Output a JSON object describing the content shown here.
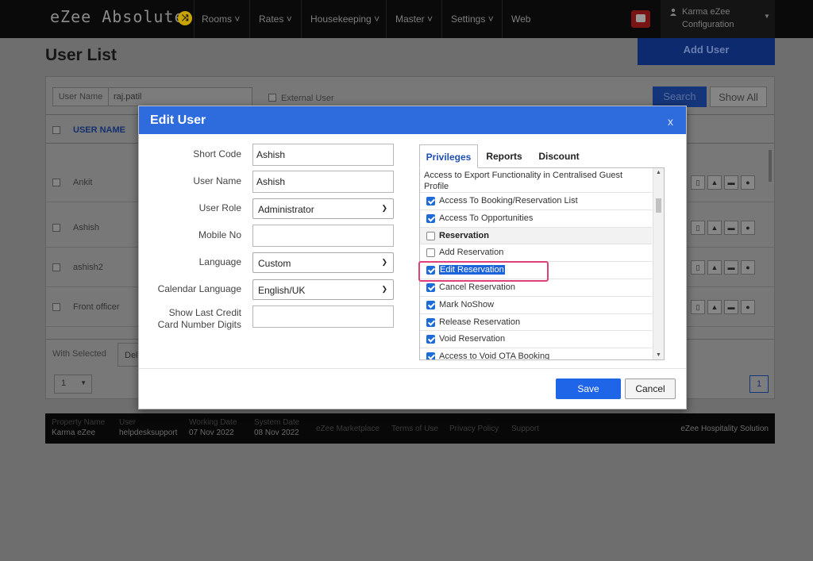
{
  "app": {
    "brand": "eZee Absolute",
    "nav": [
      "Rooms",
      "Rates",
      "Housekeeping",
      "Master",
      "Settings",
      "Web"
    ],
    "user_line1": "Karma eZee",
    "user_line2": "Configuration"
  },
  "page": {
    "title": "User List",
    "add_user": "Add User",
    "filter": {
      "username_label": "User Name",
      "username_value": "raj.patil",
      "external_user": "External User",
      "search": "Search",
      "show_all": "Show All"
    },
    "table": {
      "column_name": "USER NAME",
      "rows": [
        "Ankit",
        "Ashish",
        "ashish2",
        "Front officer"
      ]
    },
    "with_selected": "With Selected",
    "delete_tab": "Del",
    "per_page": "1",
    "page_number": "1"
  },
  "footer": {
    "property_label": "Property Name",
    "property_value": "Karma eZee",
    "user_label": "User",
    "user_value": "helpdesksupport",
    "working_date_label": "Working Date",
    "working_date_value": "07 Nov 2022",
    "system_date_label": "System Date",
    "system_date_value": "08 Nov 2022",
    "links": [
      "eZee Marketplace",
      "Terms of Use",
      "Privacy Policy",
      "Support"
    ],
    "right": "eZee Hospitality Solution"
  },
  "modal": {
    "title": "Edit User",
    "close": "x",
    "fields": {
      "short_code_label": "Short Code",
      "short_code_value": "Ashish",
      "user_name_label": "User Name",
      "user_name_value": "Ashish",
      "user_role_label": "User Role",
      "user_role_value": "Administrator",
      "mobile_label": "Mobile No",
      "mobile_value": "",
      "language_label": "Language",
      "language_value": "Custom",
      "calendar_label": "Calendar Language",
      "calendar_value": "English/UK",
      "last_digits_label_1": "Show Last Credit",
      "last_digits_label_2": "Card Number Digits",
      "last_digits_value": ""
    },
    "tabs": [
      "Privileges",
      "Reports",
      "Discount"
    ],
    "privileges": [
      {
        "label": "Access to Export Functionality in Centralised Guest Profile",
        "kind": "partial"
      },
      {
        "label": "Access To Booking/Reservation List",
        "checked": true
      },
      {
        "label": "Access To Opportunities",
        "checked": true
      },
      {
        "label": "Reservation",
        "checked": false,
        "kind": "group"
      },
      {
        "label": "Add Reservation",
        "checked": false
      },
      {
        "label": "Edit Reservation",
        "checked": true,
        "selected": true
      },
      {
        "label": "Cancel Reservation",
        "checked": true
      },
      {
        "label": "Mark NoShow",
        "checked": true
      },
      {
        "label": "Release Reservation",
        "checked": true
      },
      {
        "label": "Void Reservation",
        "checked": true
      },
      {
        "label": "Access to Void OTA Booking",
        "checked": true
      }
    ],
    "save": "Save",
    "cancel": "Cancel"
  }
}
